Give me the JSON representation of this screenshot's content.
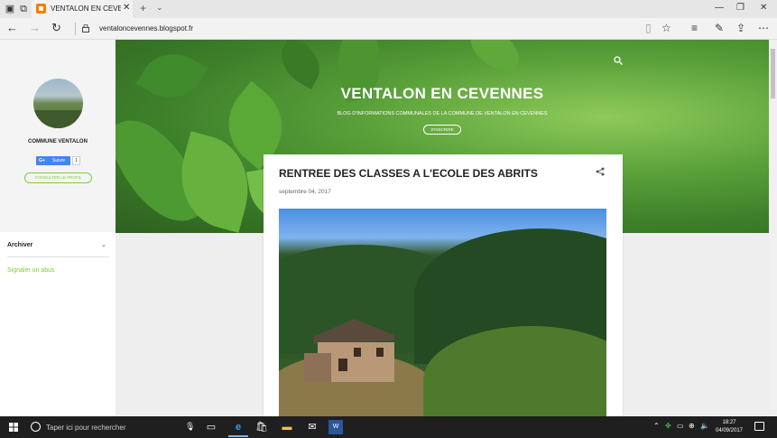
{
  "browser": {
    "tab_title": "VENTALON EN CEVENN",
    "url": "ventaloncevennes.blogspot.fr"
  },
  "sidebar": {
    "profile_name": "COMMUNE VENTALON",
    "follow_label": "Suivre",
    "follow_g": "G+",
    "follow_count": "1",
    "profile_link": "CONSULTER LE PROFIL",
    "archive_title": "Archiver",
    "report_link": "Signaler un abus"
  },
  "header": {
    "title": "VENTALON EN CEVENNES",
    "description": "BLOG D'INFORMATIONS COMMUNALES DE LA COMMUNE DE VENTALON EN CEVENNES",
    "subscribe": "S'INSCRIRE"
  },
  "post": {
    "title": "RENTREE DES CLASSES A L'ECOLE DES ABRITS",
    "date": "septembre 04, 2017"
  },
  "taskbar": {
    "search_placeholder": "Taper ici pour rechercher",
    "time": "18:27",
    "date": "04/09/2017"
  },
  "colors": {
    "accent_green": "#7ccf3a",
    "follow_blue": "#4285f4",
    "taskbar": "#1f1f1f"
  }
}
